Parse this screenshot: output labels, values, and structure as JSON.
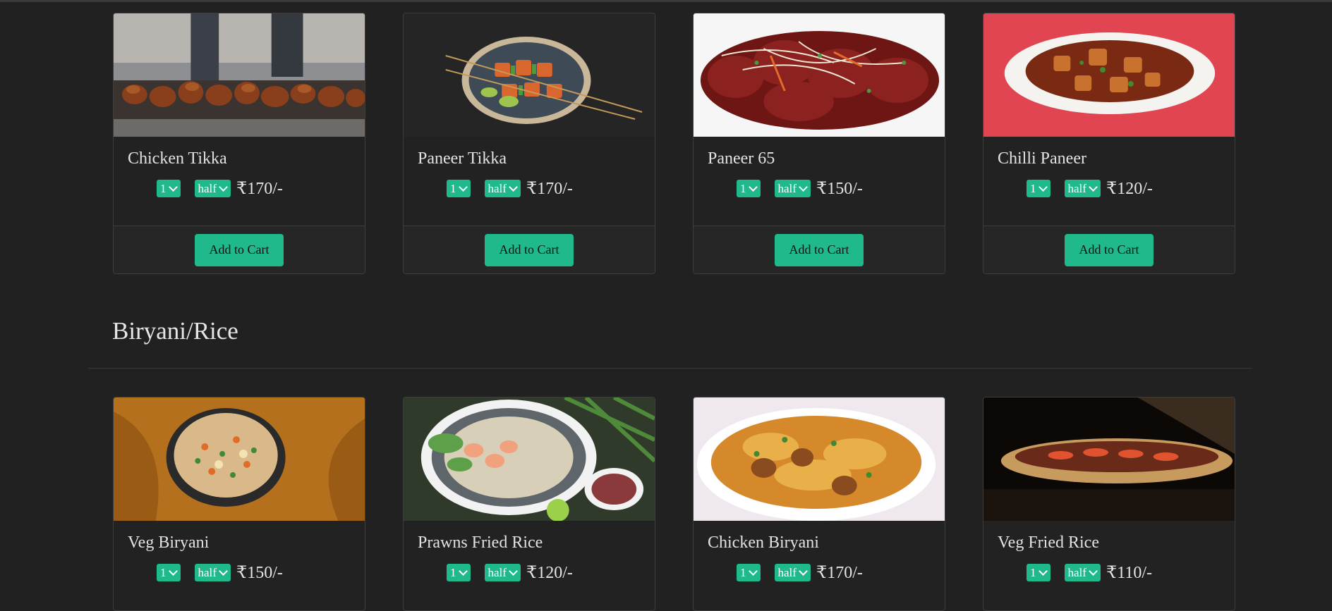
{
  "sections": [
    {
      "items": [
        {
          "name": "Chicken Tikka",
          "qty": "1",
          "size": "half",
          "price": "₹170/-",
          "button": "Add to Cart",
          "image": "chicken-tikka-skewers"
        },
        {
          "name": "Paneer Tikka",
          "qty": "1",
          "size": "half",
          "price": "₹170/-",
          "button": "Add to Cart",
          "image": "paneer-tikka-plate"
        },
        {
          "name": "Paneer 65",
          "qty": "1",
          "size": "half",
          "price": "₹150/-",
          "button": "Add to Cart",
          "image": "paneer-65-dish"
        },
        {
          "name": "Chilli Paneer",
          "qty": "1",
          "size": "half",
          "price": "₹120/-",
          "button": "Add to Cart",
          "image": "chilli-paneer-bowl"
        }
      ]
    },
    {
      "title": "Biryani/Rice",
      "items": [
        {
          "name": "Veg Biryani",
          "qty": "1",
          "size": "half",
          "price": "₹150/-",
          "image": "veg-biryani-bowl"
        },
        {
          "name": "Prawns Fried Rice",
          "qty": "1",
          "size": "half",
          "price": "₹120/-",
          "image": "prawns-fried-rice-plate"
        },
        {
          "name": "Chicken Biryani",
          "qty": "1",
          "size": "half",
          "price": "₹170/-",
          "image": "chicken-biryani-plate"
        },
        {
          "name": "Veg Fried Rice",
          "qty": "1",
          "size": "half",
          "price": "₹110/-",
          "image": "veg-fried-rice-plate"
        }
      ]
    }
  ],
  "colors": {
    "background": "#212121",
    "accent": "#1fb98b",
    "card_border": "#3d3d3d"
  }
}
